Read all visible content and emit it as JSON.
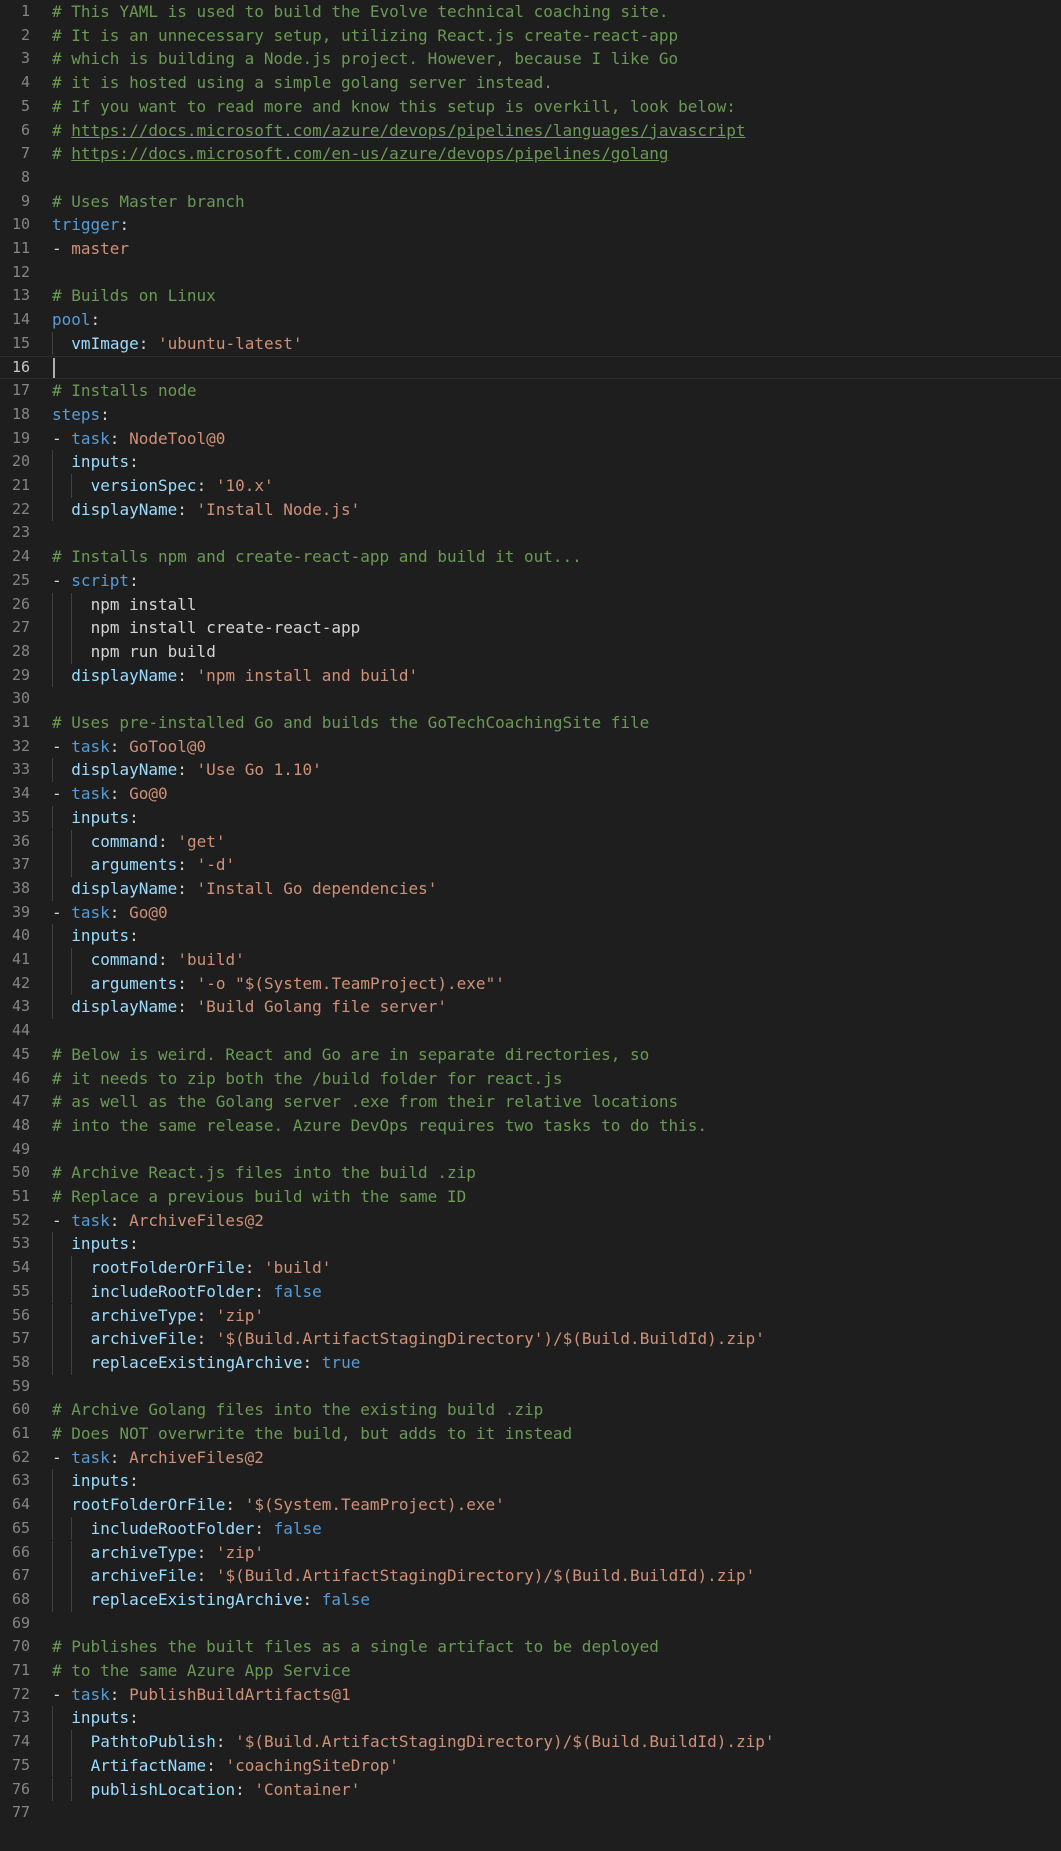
{
  "editor": {
    "language": "yaml",
    "current_line": 16,
    "colors": {
      "background": "#1e1e1e",
      "comment": "#6a9955",
      "key": "#569cd6",
      "property": "#9cdcfe",
      "string": "#ce9178",
      "line_number": "#858585"
    },
    "lines": [
      {
        "n": "1",
        "indent": 0,
        "cls": "comment",
        "text": "# This YAML is used to build the Evolve technical coaching site."
      },
      {
        "n": "2",
        "indent": 0,
        "cls": "comment",
        "text": "# It is an unnecessary setup, utilizing React.js create-react-app"
      },
      {
        "n": "3",
        "indent": 0,
        "cls": "comment",
        "text": "# which is building a Node.js project. However, because I like Go"
      },
      {
        "n": "4",
        "indent": 0,
        "cls": "comment",
        "text": "# it is hosted using a simple golang server instead."
      },
      {
        "n": "5",
        "indent": 0,
        "cls": "comment",
        "text": "# If you want to read more and know this setup is overkill, look below:"
      },
      {
        "n": "6",
        "indent": 0,
        "cls": "link",
        "prefix": "# ",
        "text": "https://docs.microsoft.com/azure/devops/pipelines/languages/javascript"
      },
      {
        "n": "7",
        "indent": 0,
        "cls": "link",
        "prefix": "# ",
        "text": "https://docs.microsoft.com/en-us/azure/devops/pipelines/golang"
      },
      {
        "n": "8",
        "indent": 0,
        "cls": "empty",
        "text": ""
      },
      {
        "n": "9",
        "indent": 0,
        "cls": "comment",
        "text": "# Uses Master branch"
      },
      {
        "n": "10",
        "indent": 0,
        "cls": "key",
        "key": "trigger",
        "value": ""
      },
      {
        "n": "11",
        "indent": 0,
        "cls": "listplain",
        "text": "master"
      },
      {
        "n": "12",
        "indent": 0,
        "cls": "empty",
        "text": ""
      },
      {
        "n": "13",
        "indent": 0,
        "cls": "comment",
        "text": "# Builds on Linux"
      },
      {
        "n": "14",
        "indent": 0,
        "cls": "key",
        "key": "pool",
        "value": ""
      },
      {
        "n": "15",
        "indent": 1,
        "cls": "prop",
        "key": "vmImage",
        "value": "'ubuntu-latest'"
      },
      {
        "n": "16",
        "indent": 0,
        "cls": "empty",
        "text": ""
      },
      {
        "n": "17",
        "indent": 0,
        "cls": "comment",
        "text": "# Installs node"
      },
      {
        "n": "18",
        "indent": 0,
        "cls": "key",
        "key": "steps",
        "value": ""
      },
      {
        "n": "19",
        "indent": 0,
        "cls": "listkey",
        "key": "task",
        "value": "NodeTool@0"
      },
      {
        "n": "20",
        "indent": 1,
        "cls": "prop",
        "key": "inputs",
        "value": ""
      },
      {
        "n": "21",
        "indent": 2,
        "cls": "prop",
        "key": "versionSpec",
        "value": "'10.x'"
      },
      {
        "n": "22",
        "indent": 1,
        "cls": "prop",
        "key": "displayName",
        "value": "'Install Node.js'"
      },
      {
        "n": "23",
        "indent": 0,
        "cls": "empty",
        "text": ""
      },
      {
        "n": "24",
        "indent": 0,
        "cls": "comment",
        "text": "# Installs npm and create-react-app and build it out..."
      },
      {
        "n": "25",
        "indent": 0,
        "cls": "listkey",
        "key": "script",
        "value": "|"
      },
      {
        "n": "26",
        "indent": 2,
        "cls": "plain",
        "text": "npm install"
      },
      {
        "n": "27",
        "indent": 2,
        "cls": "plain",
        "text": "npm install create-react-app"
      },
      {
        "n": "28",
        "indent": 2,
        "cls": "plain",
        "text": "npm run build"
      },
      {
        "n": "29",
        "indent": 1,
        "cls": "prop",
        "key": "displayName",
        "value": "'npm install and build'"
      },
      {
        "n": "30",
        "indent": 0,
        "cls": "empty",
        "text": ""
      },
      {
        "n": "31",
        "indent": 0,
        "cls": "comment",
        "text": "# Uses pre-installed Go and builds the GoTechCoachingSite file"
      },
      {
        "n": "32",
        "indent": 0,
        "cls": "listkey",
        "key": "task",
        "value": "GoTool@0"
      },
      {
        "n": "33",
        "indent": 1,
        "cls": "prop",
        "key": "displayName",
        "value": "'Use Go 1.10'"
      },
      {
        "n": "34",
        "indent": 0,
        "cls": "listkey",
        "key": "task",
        "value": "Go@0"
      },
      {
        "n": "35",
        "indent": 1,
        "cls": "prop",
        "key": "inputs",
        "value": ""
      },
      {
        "n": "36",
        "indent": 2,
        "cls": "prop",
        "key": "command",
        "value": "'get'"
      },
      {
        "n": "37",
        "indent": 2,
        "cls": "prop",
        "key": "arguments",
        "value": "'-d'"
      },
      {
        "n": "38",
        "indent": 1,
        "cls": "prop",
        "key": "displayName",
        "value": "'Install Go dependencies'"
      },
      {
        "n": "39",
        "indent": 0,
        "cls": "listkey",
        "key": "task",
        "value": "Go@0"
      },
      {
        "n": "40",
        "indent": 1,
        "cls": "prop",
        "key": "inputs",
        "value": ""
      },
      {
        "n": "41",
        "indent": 2,
        "cls": "prop",
        "key": "command",
        "value": "'build'"
      },
      {
        "n": "42",
        "indent": 2,
        "cls": "prop",
        "key": "arguments",
        "value": "'-o \"$(System.TeamProject).exe\"'"
      },
      {
        "n": "43",
        "indent": 1,
        "cls": "prop",
        "key": "displayName",
        "value": "'Build Golang file server'"
      },
      {
        "n": "44",
        "indent": 0,
        "cls": "empty",
        "text": ""
      },
      {
        "n": "45",
        "indent": 0,
        "cls": "comment",
        "text": "# Below is weird. React and Go are in separate directories, so"
      },
      {
        "n": "46",
        "indent": 0,
        "cls": "comment",
        "text": "# it needs to zip both the /build folder for react.js"
      },
      {
        "n": "47",
        "indent": 0,
        "cls": "comment",
        "text": "# as well as the Golang server .exe from their relative locations"
      },
      {
        "n": "48",
        "indent": 0,
        "cls": "comment",
        "text": "# into the same release. Azure DevOps requires two tasks to do this."
      },
      {
        "n": "49",
        "indent": 0,
        "cls": "empty",
        "text": ""
      },
      {
        "n": "50",
        "indent": 0,
        "cls": "comment",
        "text": "# Archive React.js files into the build .zip"
      },
      {
        "n": "51",
        "indent": 0,
        "cls": "comment",
        "text": "# Replace a previous build with the same ID"
      },
      {
        "n": "52",
        "indent": 0,
        "cls": "listkey",
        "key": "task",
        "value": "ArchiveFiles@2"
      },
      {
        "n": "53",
        "indent": 1,
        "cls": "prop",
        "key": "inputs",
        "value": ""
      },
      {
        "n": "54",
        "indent": 2,
        "cls": "prop",
        "key": "rootFolderOrFile",
        "value": "'build'"
      },
      {
        "n": "55",
        "indent": 2,
        "cls": "propbool",
        "key": "includeRootFolder",
        "value": "false"
      },
      {
        "n": "56",
        "indent": 2,
        "cls": "prop",
        "key": "archiveType",
        "value": "'zip'"
      },
      {
        "n": "57",
        "indent": 2,
        "cls": "prop",
        "key": "archiveFile",
        "value": "'$(Build.ArtifactStagingDirectory')/$(Build.BuildId).zip'"
      },
      {
        "n": "58",
        "indent": 2,
        "cls": "propbool",
        "key": "replaceExistingArchive",
        "value": "true"
      },
      {
        "n": "59",
        "indent": 0,
        "cls": "empty",
        "text": ""
      },
      {
        "n": "60",
        "indent": 0,
        "cls": "comment",
        "text": "# Archive Golang files into the existing build .zip"
      },
      {
        "n": "61",
        "indent": 0,
        "cls": "comment",
        "text": "# Does NOT overwrite the build, but adds to it instead"
      },
      {
        "n": "62",
        "indent": 0,
        "cls": "listkey",
        "key": "task",
        "value": "ArchiveFiles@2"
      },
      {
        "n": "63",
        "indent": 1,
        "cls": "prop",
        "key": "inputs",
        "value": ""
      },
      {
        "n": "64",
        "indent": 1,
        "cls": "prop",
        "key": "rootFolderOrFile",
        "value": "'$(System.TeamProject).exe'"
      },
      {
        "n": "65",
        "indent": 2,
        "cls": "propbool",
        "key": "includeRootFolder",
        "value": "false"
      },
      {
        "n": "66",
        "indent": 2,
        "cls": "prop",
        "key": "archiveType",
        "value": "'zip'"
      },
      {
        "n": "67",
        "indent": 2,
        "cls": "prop",
        "key": "archiveFile",
        "value": "'$(Build.ArtifactStagingDirectory)/$(Build.BuildId).zip'"
      },
      {
        "n": "68",
        "indent": 2,
        "cls": "propbool",
        "key": "replaceExistingArchive",
        "value": "false"
      },
      {
        "n": "69",
        "indent": 0,
        "cls": "empty",
        "text": ""
      },
      {
        "n": "70",
        "indent": 0,
        "cls": "comment",
        "text": "# Publishes the built files as a single artifact to be deployed"
      },
      {
        "n": "71",
        "indent": 0,
        "cls": "comment",
        "text": "# to the same Azure App Service"
      },
      {
        "n": "72",
        "indent": 0,
        "cls": "listkey",
        "key": "task",
        "value": "PublishBuildArtifacts@1"
      },
      {
        "n": "73",
        "indent": 1,
        "cls": "prop",
        "key": "inputs",
        "value": ""
      },
      {
        "n": "74",
        "indent": 2,
        "cls": "prop",
        "key": "PathtoPublish",
        "value": "'$(Build.ArtifactStagingDirectory)/$(Build.BuildId).zip'"
      },
      {
        "n": "75",
        "indent": 2,
        "cls": "prop",
        "key": "ArtifactName",
        "value": "'coachingSiteDrop'"
      },
      {
        "n": "76",
        "indent": 2,
        "cls": "prop",
        "key": "publishLocation",
        "value": "'Container'"
      },
      {
        "n": "77",
        "indent": 0,
        "cls": "empty",
        "text": ""
      }
    ]
  }
}
